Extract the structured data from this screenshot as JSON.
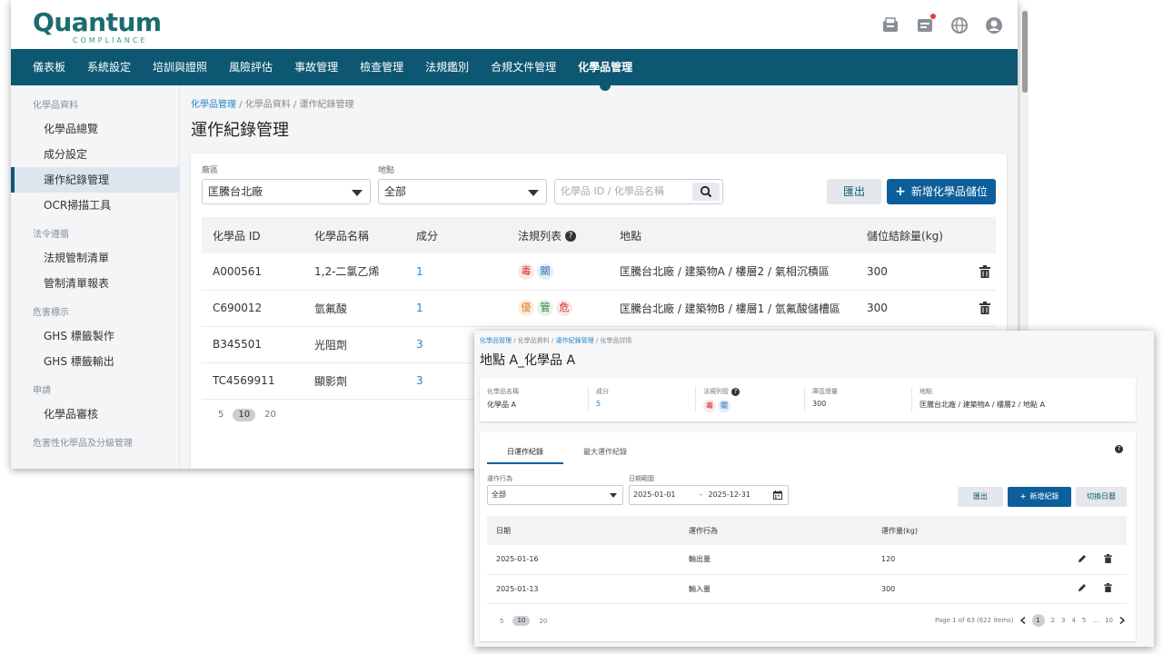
{
  "brand": {
    "name_q": "Q",
    "name_rest": "uantum",
    "sub": "COMPLIANCE"
  },
  "nav": [
    "儀表板",
    "系統設定",
    "培訓與證照",
    "風險評估",
    "事故管理",
    "檢查管理",
    "法規鑑別",
    "合規文件管理",
    "化學品管理"
  ],
  "sidebar": {
    "groups": [
      {
        "label": "化學品資料",
        "items": [
          "化學品總覽",
          "成分設定",
          "運作紀錄管理",
          "OCR掃描工具"
        ]
      },
      {
        "label": "法令遵循",
        "items": [
          "法規管制清單",
          "管制清單報表"
        ]
      },
      {
        "label": "危害標示",
        "items": [
          "GHS 標籤製作",
          "GHS 標籤輸出"
        ]
      },
      {
        "label": "申請",
        "items": [
          "化學品審核"
        ]
      },
      {
        "label": "危害性化學品及分級管理",
        "items": []
      }
    ]
  },
  "main": {
    "crumb": {
      "first": "化學品管理",
      "rest": " / 化學品資料 / 運作紀錄管理"
    },
    "title": "運作紀錄管理",
    "filters": {
      "plant_label": "廠區",
      "plant_value": "匡騰台北廠",
      "site_label": "地點",
      "site_value": "全部",
      "search_placeholder": "化學品 ID / 化學品名稱"
    },
    "export_label": "匯出",
    "add_label": "新增化學品儲位",
    "add_plus": "+",
    "columns": [
      "化學品 ID",
      "化學品名稱",
      "成分",
      "法規列表",
      "地點",
      "儲位結餘量(kg)"
    ],
    "help_glyph": "?",
    "rows": [
      {
        "id": "A000561",
        "name": "1,2-二氯乙烯",
        "comp": "1",
        "tags": [
          "毒",
          "關"
        ],
        "loc": "匡騰台北廠 / 建築物A / 樓層2 / 氣相沉積區",
        "qty": "300"
      },
      {
        "id": "C690012",
        "name": "氫氟酸",
        "comp": "1",
        "tags": [
          "優",
          "管",
          "危"
        ],
        "loc": "匡騰台北廠 / 建築物B / 樓層1 / 氫氟酸儲槽區",
        "qty": "300"
      },
      {
        "id": "B345501",
        "name": "光阻劑",
        "comp": "3",
        "tags": [],
        "loc": "",
        "qty": ""
      },
      {
        "id": "TC4569911",
        "name": "顯影劑",
        "comp": "3",
        "tags": [],
        "loc": "",
        "qty": ""
      }
    ],
    "page_sizes": [
      "5",
      "10",
      "20"
    ]
  },
  "detail": {
    "crumb": {
      "a": "化學品管理",
      "b": " / 化學品資料 / ",
      "c": "運作紀錄管理",
      "d": " / 化學品詳情"
    },
    "title": "地點 A_化學品 A",
    "info": [
      {
        "label": "化學品名稱",
        "value": "化學品 A"
      },
      {
        "label": "成分",
        "value": "5"
      },
      {
        "label": "法規列管",
        "tags": [
          "毒",
          "關"
        ]
      },
      {
        "label": "庫區總量",
        "value": "300"
      },
      {
        "label": "地點",
        "value": "匡騰台北廠 / 建築物A / 樓層2 / 地點 A"
      }
    ],
    "tabs": [
      "日運作紀錄",
      "最大運作紀錄"
    ],
    "filters": {
      "action_label": "運作行為",
      "action_value": "全部",
      "range_label": "日期範圍",
      "date_from": "2025-01-01",
      "date_sep": "-",
      "date_to": "2025-12-31"
    },
    "export_label": "匯出",
    "add_label": "新增紀錄",
    "add_plus": "+",
    "toggle_label": "切換日曆",
    "columns": [
      "日期",
      "運作行為",
      "運作量(kg)"
    ],
    "rows": [
      {
        "date": "2025-01-16",
        "action": "輸出量",
        "qty": "120"
      },
      {
        "date": "2025-01-13",
        "action": "輸入量",
        "qty": "300"
      }
    ],
    "page_sizes": [
      "5",
      "10",
      "20"
    ],
    "page_info": "Page 1 of 63 (622 items)",
    "pages": [
      "1",
      "2",
      "3",
      "4",
      "5",
      "...",
      "10"
    ]
  }
}
